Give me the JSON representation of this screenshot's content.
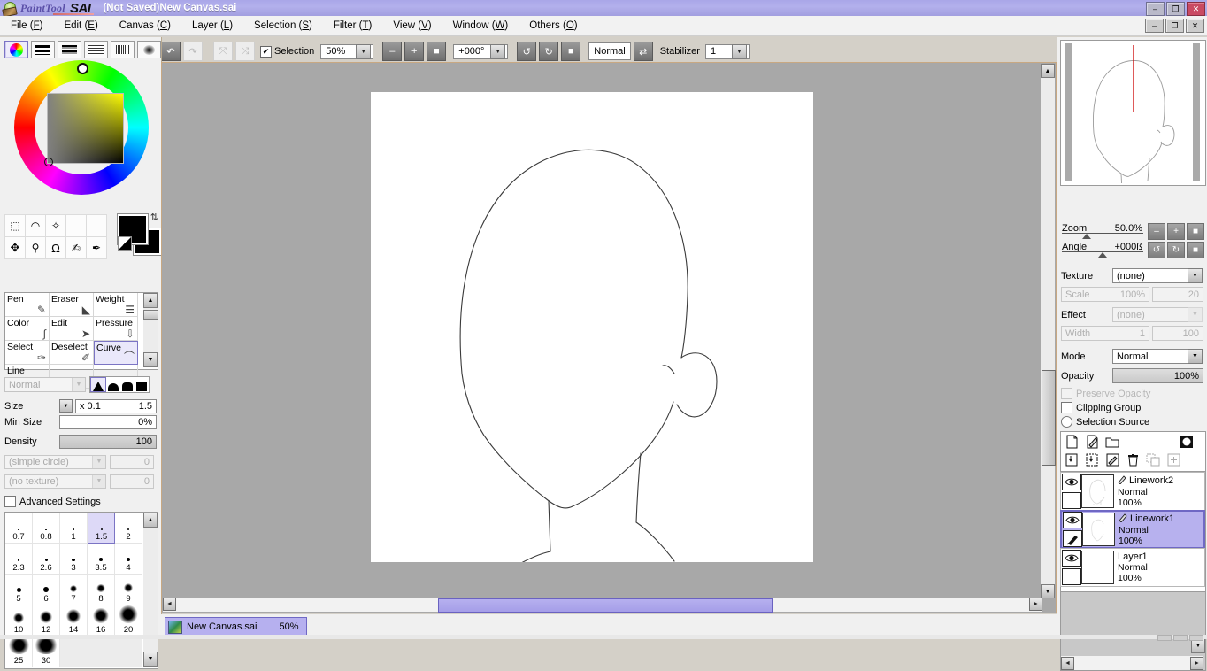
{
  "titlebar": {
    "brand_paint": "PaintTool",
    "brand_sai": "SAI",
    "document_title": "(Not Saved)New Canvas.sai",
    "minimize": "–",
    "maximize": "❐",
    "close": "✕"
  },
  "menubar": {
    "items": [
      {
        "label": "File",
        "accel": "F"
      },
      {
        "label": "Edit",
        "accel": "E"
      },
      {
        "label": "Canvas",
        "accel": "C"
      },
      {
        "label": "Layer",
        "accel": "L"
      },
      {
        "label": "Selection",
        "accel": "S"
      },
      {
        "label": "Filter",
        "accel": "T"
      },
      {
        "label": "View",
        "accel": "V"
      },
      {
        "label": "Window",
        "accel": "W"
      },
      {
        "label": "Others",
        "accel": "O"
      }
    ],
    "minimize": "–",
    "maximize": "❐",
    "close": "✕"
  },
  "toolbar": {
    "undo": "↶",
    "redo": "↷",
    "flip_h_label": "⤧",
    "flip_v_label": "⤨",
    "selection_checkbox_label": "Selection",
    "selection_checked": "✔",
    "zoom_value": "50%",
    "zoom_out": "–",
    "zoom_in": "+",
    "zoom_reset": "■",
    "angle_value": "+000°",
    "rotate_ccw": "↺",
    "rotate_cw": "↻",
    "rotate_reset": "■",
    "view_mode": "Normal",
    "flip_toggle": "⇄",
    "stabilizer_label": "Stabilizer",
    "stabilizer_value": "1",
    "dropdown_arrow": "▼"
  },
  "colorpanel": {
    "tabs": [
      "color-wheel-tab",
      "rgb-slider-tab",
      "hsv-slider-tab",
      "color-list-tab",
      "swatch-grid-tab",
      "gradient-tab"
    ],
    "selected_tab": 0,
    "hue_marker_deg": 90,
    "foreground_color": "#000000",
    "background_color": "#000000",
    "swap_icon": "⇅",
    "square_top_color": "#ffff00"
  },
  "tools": {
    "row1": [
      "rect-select-icon",
      "lasso-icon",
      "magic-wand-icon",
      "blank-tool-1",
      "blank-tool-2"
    ],
    "row2": [
      "move-icon",
      "zoom-icon",
      "rotate-icon",
      "hand-icon",
      "eyedropper-icon"
    ],
    "row1_glyphs": [
      "▭",
      "◠",
      "✦",
      "",
      ""
    ],
    "row2_glyphs": [
      "✥",
      "🔍",
      "↻",
      "✋",
      "✐"
    ]
  },
  "tool_options": {
    "cells": [
      {
        "label": "Pen",
        "glyph": "✎",
        "selected": false
      },
      {
        "label": "Eraser",
        "glyph": "◣",
        "selected": false
      },
      {
        "label": "Weight",
        "glyph": "☰",
        "selected": false
      },
      {
        "label": "Color",
        "glyph": "∫",
        "selected": false
      },
      {
        "label": "Edit",
        "glyph": "➤",
        "selected": false
      },
      {
        "label": "Pressure",
        "glyph": "⇩",
        "selected": false
      },
      {
        "label": "Select",
        "glyph": "✑",
        "selected": false
      },
      {
        "label": "Deselect",
        "glyph": "✐",
        "selected": false
      },
      {
        "label": "Curve",
        "glyph": "⌒",
        "selected": true
      },
      {
        "label": "Line",
        "glyph": "·",
        "selected": false
      },
      {
        "label": "",
        "glyph": "",
        "selected": false
      },
      {
        "label": "",
        "glyph": "",
        "selected": false
      }
    ],
    "scroll_up": "▲",
    "scroll_down": "▼"
  },
  "brush_settings": {
    "blend_mode": "Normal",
    "blend_disabled": true,
    "shape_selected": 0,
    "size_label": "Size",
    "size_mult": "x 0.1",
    "size_value": "1.5",
    "minsize_label": "Min Size",
    "minsize_value": "0%",
    "density_label": "Density",
    "density_value": "100",
    "shape_combo": "(simple circle)",
    "shape_combo_value": "0",
    "texture_combo": "(no texture)",
    "texture_combo_value": "0",
    "advanced_label": "Advanced Settings",
    "advanced_checked": false
  },
  "brush_sizes": {
    "selected": "1.5",
    "items": [
      {
        "label": "0.7",
        "dot": 1.2
      },
      {
        "label": "0.8",
        "dot": 1.4
      },
      {
        "label": "1",
        "dot": 1.6
      },
      {
        "label": "1.5",
        "dot": 2.0
      },
      {
        "label": "2",
        "dot": 2.4
      },
      {
        "label": "2.3",
        "dot": 2.7
      },
      {
        "label": "2.6",
        "dot": 3.0
      },
      {
        "label": "3",
        "dot": 3.4
      },
      {
        "label": "3.5",
        "dot": 3.8
      },
      {
        "label": "4",
        "dot": 4.2
      },
      {
        "label": "5",
        "dot": 5.0
      },
      {
        "label": "6",
        "dot": 5.8
      },
      {
        "label": "7",
        "dot": 6.6
      },
      {
        "label": "8",
        "dot": 7.4
      },
      {
        "label": "9",
        "dot": 8.2
      },
      {
        "label": "10",
        "dot": 9.5
      },
      {
        "label": "12",
        "dot": 11
      },
      {
        "label": "14",
        "dot": 12.5
      },
      {
        "label": "16",
        "dot": 14
      },
      {
        "label": "20",
        "dot": 17
      },
      {
        "label": "25",
        "dot": 20
      },
      {
        "label": "30",
        "dot": 22
      }
    ]
  },
  "navigator": {
    "zoom_label": "Zoom",
    "zoom_value": "50.0%",
    "angle_label": "Angle",
    "angle_value": "+000ß",
    "zoom_out": "–",
    "zoom_in": "+",
    "zoom_reset": "■",
    "rotate_ccw": "↺",
    "rotate_cw": "↻",
    "rotate_reset": "■",
    "guide_line_color": "#cc0000"
  },
  "layer_settings": {
    "texture_label": "Texture",
    "texture_value": "(none)",
    "scale_label": "Scale",
    "scale_value": "100%",
    "scale_num": "20",
    "effect_label": "Effect",
    "effect_value": "(none)",
    "width_label": "Width",
    "width_value": "1",
    "width_num": "100",
    "mode_label": "Mode",
    "mode_value": "Normal",
    "opacity_label": "Opacity",
    "opacity_value": "100%",
    "preserve_opacity": "Preserve Opacity",
    "clipping_group": "Clipping Group",
    "selection_source": "Selection Source",
    "dropdown_arrow": "▼"
  },
  "layer_buttons": {
    "row1": [
      "new-layer-icon",
      "new-linework-layer-icon",
      "new-folder-icon",
      "layer-mask-icon"
    ],
    "row2": [
      "merge-down-icon",
      "merge-group-icon",
      "clear-layer-icon",
      "delete-layer-icon",
      "transfer-icon",
      "add-mask-icon"
    ]
  },
  "layers": [
    {
      "name": "Linework2",
      "mode": "Normal",
      "opacity": "100%",
      "visible": true,
      "selected": false,
      "type": "linework"
    },
    {
      "name": "Linework1",
      "mode": "Normal",
      "opacity": "100%",
      "visible": true,
      "selected": true,
      "type": "linework"
    },
    {
      "name": "Layer1",
      "mode": "Normal",
      "opacity": "100%",
      "visible": true,
      "selected": false,
      "type": "raster"
    }
  ],
  "document_tab": {
    "name": "New Canvas.sai",
    "zoom": "50%"
  },
  "scrollbars": {
    "left_arrow": "◄",
    "right_arrow": "►",
    "up_arrow": "▲",
    "down_arrow": "▼"
  }
}
